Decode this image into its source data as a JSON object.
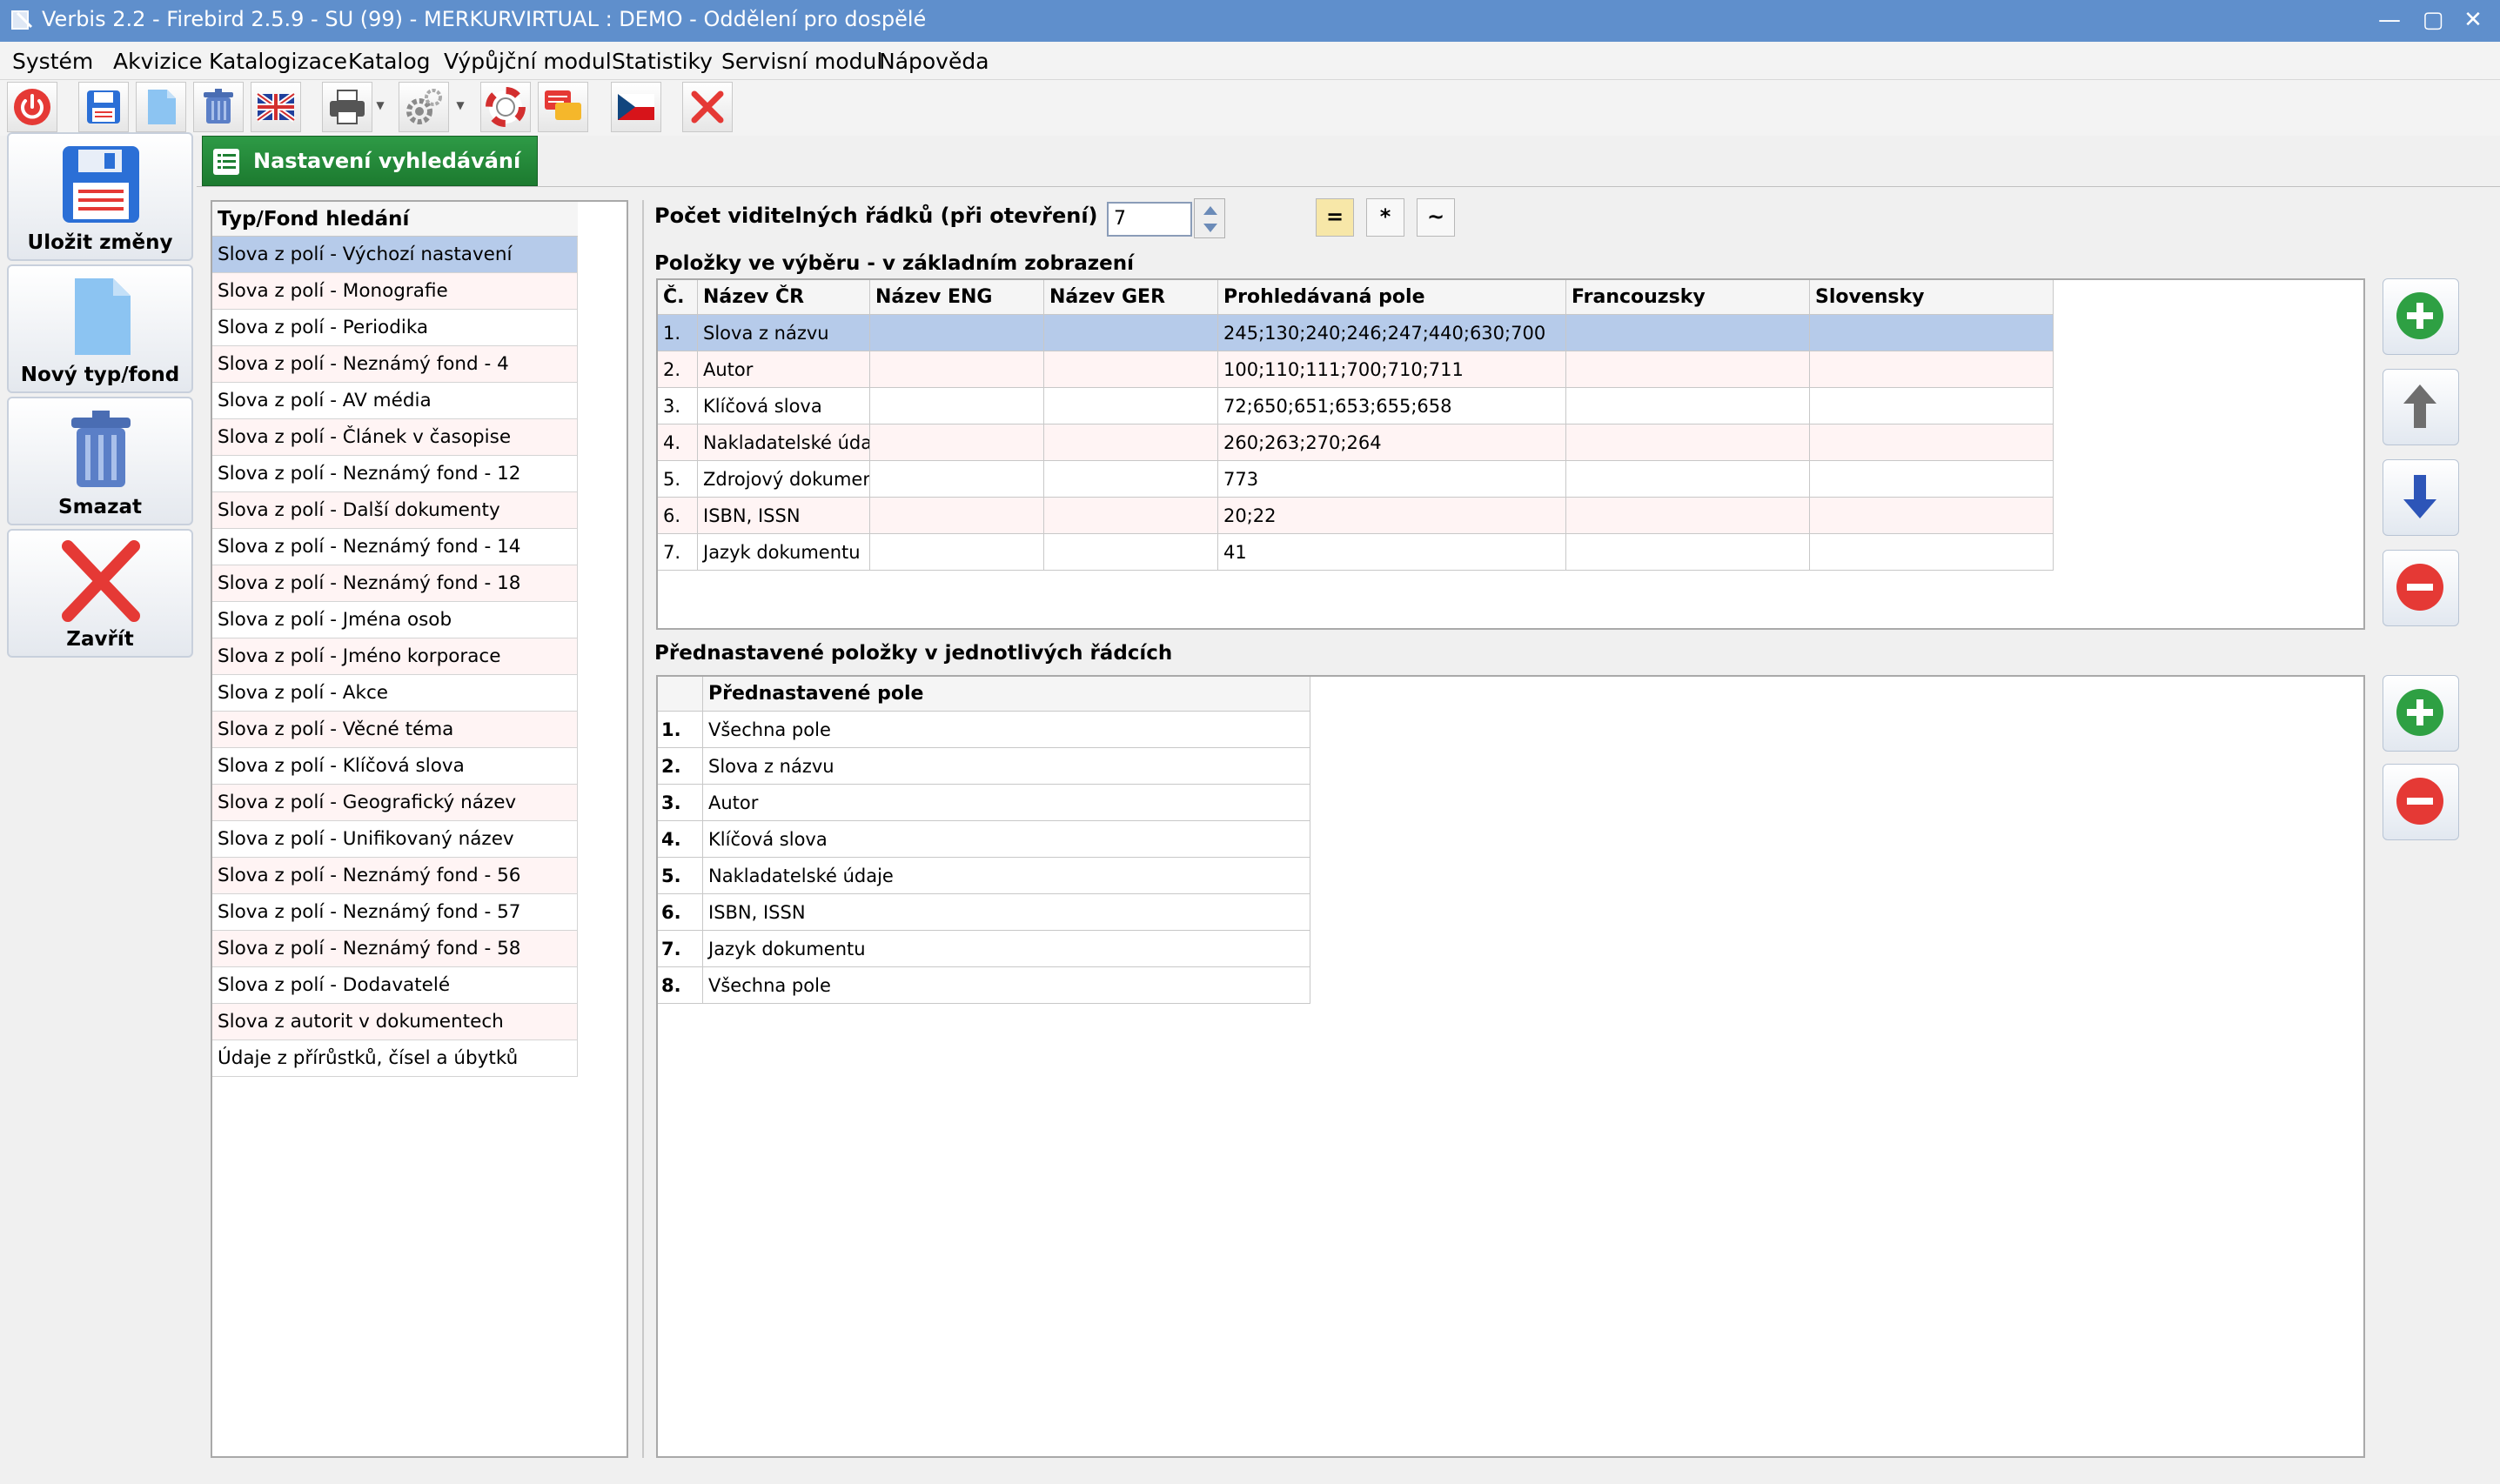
{
  "window": {
    "title": "Verbis 2.2 - Firebird 2.5.9 - SU (99) - MERKURVIRTUAL : DEMO - Oddělení pro dospělé",
    "controls": [
      "—",
      "▢",
      "✕"
    ]
  },
  "menu": [
    "Systém",
    "Akvizice",
    "Katalogizace",
    "Katalog",
    "Výpůjční modul",
    "Statistiky",
    "Servisní modul",
    "Nápověda"
  ],
  "toolbar_icons": [
    "power-icon",
    "save-icon",
    "new-document-icon",
    "trash-icon",
    "uk-flag-icon",
    "printer-icon",
    "gear-icon",
    "lifebuoy-icon",
    "chat-icon",
    "czech-flag-icon",
    "close-icon"
  ],
  "left_actions": {
    "save": "Uložit změny",
    "new": "Nový typ/fond",
    "delete": "Smazat",
    "close": "Zavřít"
  },
  "tab": {
    "label": "Nastavení vyhledávání"
  },
  "fond_list": {
    "header": "Typ/Fond hledání",
    "items": [
      "Slova z polí - Výchozí nastavení",
      "Slova z polí - Monografie",
      "Slova z polí - Periodika",
      "Slova z polí - Neznámý fond - 4",
      "Slova z polí - AV média",
      "Slova z polí - Článek v časopise",
      "Slova z polí - Neznámý fond - 12",
      "Slova z polí - Další dokumenty",
      "Slova z polí - Neznámý fond - 14",
      "Slova z polí - Neznámý fond - 18",
      "Slova z polí - Jména osob",
      "Slova z polí - Jméno korporace",
      "Slova z polí - Akce",
      "Slova z polí - Věcné téma",
      "Slova z polí - Klíčová slova",
      "Slova z polí - Geografický název",
      "Slova z polí - Unifikovaný název",
      "Slova z polí - Neznámý fond - 56",
      "Slova z polí - Neznámý fond - 57",
      "Slova z polí - Neznámý fond - 58",
      "Slova z polí - Dodavatelé",
      "Slova z autorit v dokumentech",
      "Údaje z přírůstků, čísel a úbytků"
    ]
  },
  "visible_rows": {
    "label": "Počet viditelných řádků  (při otevření)",
    "value": "7",
    "modes": [
      "=",
      "*",
      "~"
    ]
  },
  "selection_grid": {
    "label": "Položky ve výběru - v základním zobrazení",
    "columns": [
      "Č.",
      "Název ČR",
      "Název ENG",
      "Název GER",
      "Prohledávaná pole",
      "Francouzsky",
      "Slovensky"
    ],
    "rows": [
      [
        "1.",
        "Slova z názvu",
        "",
        "",
        "245;130;240;246;247;440;630;700",
        "",
        ""
      ],
      [
        "2.",
        "Autor",
        "",
        "",
        "100;110;111;700;710;711",
        "",
        ""
      ],
      [
        "3.",
        "Klíčová slova",
        "",
        "",
        "72;650;651;653;655;658",
        "",
        ""
      ],
      [
        "4.",
        "Nakladatelské údaje",
        "",
        "",
        "260;263;270;264",
        "",
        ""
      ],
      [
        "5.",
        "Zdrojový dokument",
        "",
        "",
        "773",
        "",
        ""
      ],
      [
        "6.",
        "ISBN, ISSN",
        "",
        "",
        "20;22",
        "",
        ""
      ],
      [
        "7.",
        "Jazyk dokumentu",
        "",
        "",
        "41",
        "",
        ""
      ]
    ]
  },
  "preset_grid": {
    "label": "Přednastavené položky v jednotlivých řádcích",
    "column": "Přednastavené pole",
    "rows": [
      [
        "1.",
        "Všechna pole"
      ],
      [
        "2.",
        "Slova z názvu"
      ],
      [
        "3.",
        "Autor"
      ],
      [
        "4.",
        "Klíčová slova"
      ],
      [
        "5.",
        "Nakladatelské údaje"
      ],
      [
        "6.",
        "ISBN, ISSN"
      ],
      [
        "7.",
        "Jazyk dokumentu"
      ],
      [
        "8.",
        "Všechna pole"
      ]
    ]
  },
  "side_buttons": [
    "add-icon",
    "arrow-up-icon",
    "arrow-down-icon",
    "remove-icon",
    "add-icon",
    "remove-icon"
  ],
  "colors": {
    "titlebar": "#5f8fcc",
    "tab": "#1f7f33",
    "selection": "#b6cbea",
    "alt_row": "#fff4f4",
    "add": "#2ea043",
    "remove": "#e53935"
  }
}
